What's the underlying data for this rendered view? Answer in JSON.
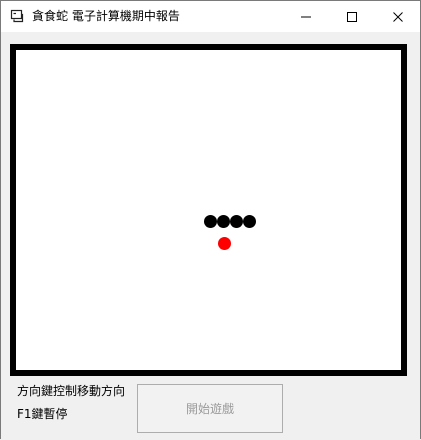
{
  "window": {
    "title": "貪食蛇 電子計算機期中報告",
    "icon": "app-window-icon",
    "controls": {
      "minimize_icon": "minimize-icon",
      "maximize_icon": "maximize-icon",
      "close_icon": "close-icon"
    }
  },
  "game": {
    "snake_color": "#000000",
    "food_color": "#ff0000",
    "board_border_color": "#000000"
  },
  "instructions": {
    "line1": "方向鍵控制移動方向",
    "line2": "F1鍵暫停"
  },
  "actions": {
    "start_button": "開始遊戲",
    "start_button_enabled": false
  }
}
